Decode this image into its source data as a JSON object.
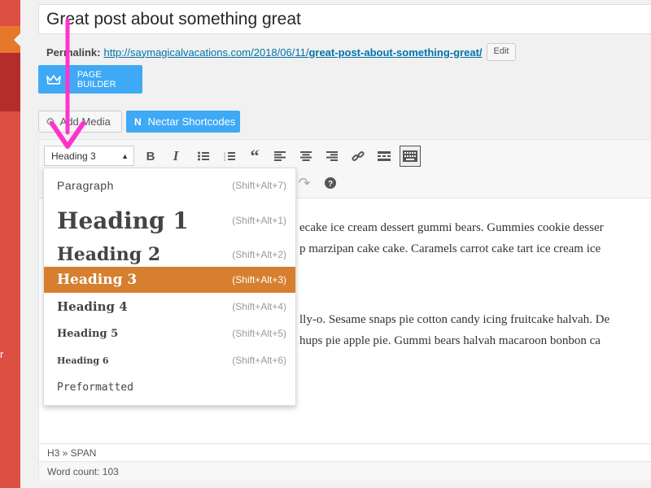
{
  "sidebar": {
    "partial_text": "r"
  },
  "post": {
    "title": "Great post about something great"
  },
  "permalink": {
    "label": "Permalink:",
    "url_base": "http://saymagicalvacations.com/2018/06/11/",
    "url_slug": "great-post-about-something-great/",
    "edit_label": "Edit"
  },
  "page_builder": {
    "label": "PAGE BUILDER"
  },
  "media_buttons": {
    "add_media": "Add Media",
    "nectar": "Nectar Shortcodes"
  },
  "toolbar": {
    "format_value": "Heading 3",
    "icons": [
      "bold-icon",
      "italic-icon",
      "bullet-list-icon",
      "numbered-list-icon",
      "blockquote-icon",
      "align-left-icon",
      "align-center-icon",
      "align-right-icon",
      "link-icon",
      "read-more-icon",
      "toolbar-toggle-icon",
      "redo-icon",
      "help-icon"
    ]
  },
  "format_menu": {
    "items": [
      {
        "label": "Paragraph",
        "shortcut": "(Shift+Alt+7)"
      },
      {
        "label": "Heading 1",
        "shortcut": "(Shift+Alt+1)"
      },
      {
        "label": "Heading 2",
        "shortcut": "(Shift+Alt+2)"
      },
      {
        "label": "Heading 3",
        "shortcut": "(Shift+Alt+3)",
        "selected": true
      },
      {
        "label": "Heading 4",
        "shortcut": "(Shift+Alt+4)"
      },
      {
        "label": "Heading 5",
        "shortcut": "(Shift+Alt+5)"
      },
      {
        "label": "Heading 6",
        "shortcut": "(Shift+Alt+6)"
      },
      {
        "label": "Preformatted",
        "shortcut": ""
      }
    ]
  },
  "content": {
    "lines": [
      "ecake ice cream dessert gummi bears. Gummies cookie desser",
      "p marzipan cake cake. Caramels carrot cake tart ice cream ice",
      "lly-o. Sesame snaps pie cotton candy icing fruitcake halvah. De",
      "hups pie apple pie. Gummi bears halvah macaroon bonbon ca"
    ]
  },
  "status": {
    "path": "H3 » SPAN",
    "word_count": "Word count: 103"
  },
  "colors": {
    "accent_magenta": "#ff33cc",
    "selected_orange": "#d67f2f",
    "button_blue": "#3fa9f5",
    "sidebar_red": "#dd4e43"
  }
}
